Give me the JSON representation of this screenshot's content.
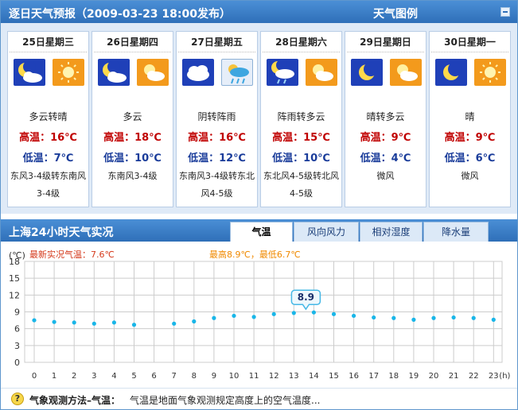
{
  "header": {
    "title": "逐日天气预报（2009-03-23 18:00发布）",
    "right_label": "天气图例"
  },
  "forecast": [
    {
      "date": "25日星期三",
      "desc": "多云转晴",
      "high": "高温：16℃",
      "low": "低温：7℃",
      "wind": "东风3-4级转东南风3-4级",
      "icon_night": "cloudy-moon-icon",
      "icon_day": "sun-icon"
    },
    {
      "date": "26日星期四",
      "desc": "多云",
      "high": "高温：18℃",
      "low": "低温：10℃",
      "wind": "东南风3-4级",
      "icon_night": "cloudy-moon-icon",
      "icon_day": "partly-cloudy-sun-icon"
    },
    {
      "date": "27日星期五",
      "desc": "阴转阵雨",
      "high": "高温：16℃",
      "low": "低温：12℃",
      "wind": "东南风3-4级转东北风4-5级",
      "icon_night": "overcast-icon",
      "icon_day": "shower-icon"
    },
    {
      "date": "28日星期六",
      "desc": "阵雨转多云",
      "high": "高温：15℃",
      "low": "低温：10℃",
      "wind": "东北风4-5级转北风4-5级",
      "icon_night": "rain-moon-icon",
      "icon_day": "partly-cloudy-sun-icon"
    },
    {
      "date": "29日星期日",
      "desc": "晴转多云",
      "high": "高温：9℃",
      "low": "低温：4℃",
      "wind": "微风",
      "icon_night": "moon-icon",
      "icon_day": "partly-cloudy-sun-icon"
    },
    {
      "date": "30日星期一",
      "desc": "晴",
      "high": "高温：9℃",
      "low": "低温：6℃",
      "wind": "微风",
      "icon_night": "moon-icon",
      "icon_day": "sun-icon"
    }
  ],
  "observation": {
    "title": "上海24小时天气实况",
    "tabs": [
      "气温",
      "风向风力",
      "相对湿度",
      "降水量"
    ],
    "active_tab": "气温",
    "latest": "最新实况气温：7.6℃",
    "hilo": "最高8.9℃，最低6.7℃",
    "unit": "(℃)",
    "x_unit": "(h)",
    "highlight_label": "8.9"
  },
  "chart_data": {
    "type": "scatter",
    "title": "",
    "xlabel": "(h)",
    "ylabel": "(℃)",
    "ylim": [
      0,
      18
    ],
    "yticks": [
      0,
      3,
      6,
      9,
      12,
      15,
      18
    ],
    "xticks": [
      0,
      1,
      2,
      3,
      4,
      5,
      6,
      7,
      8,
      9,
      10,
      11,
      12,
      13,
      14,
      15,
      16,
      17,
      18,
      19,
      20,
      21,
      22,
      23
    ],
    "grid": true,
    "series": [
      {
        "points": [
          [
            0,
            7.5
          ],
          [
            1,
            7.2
          ],
          [
            2,
            7.1
          ],
          [
            3,
            6.9
          ],
          [
            4,
            7.1
          ],
          [
            5,
            6.7
          ],
          [
            7,
            6.9
          ],
          [
            8,
            7.3
          ],
          [
            9,
            7.9
          ],
          [
            10,
            8.3
          ],
          [
            11,
            8.1
          ],
          [
            12,
            8.6
          ],
          [
            13,
            8.8
          ],
          [
            14,
            8.9
          ],
          [
            15,
            8.6
          ],
          [
            16,
            8.3
          ],
          [
            17,
            8.0
          ],
          [
            18,
            7.9
          ],
          [
            19,
            7.6
          ],
          [
            20,
            7.9
          ],
          [
            21,
            8.0
          ],
          [
            22,
            7.9
          ],
          [
            23,
            7.6
          ]
        ]
      }
    ],
    "highlight": {
      "x": 14,
      "y": 8.9
    }
  },
  "footer": {
    "bold": "气象观测方法–气温：",
    "text": "气温是地面气象观测规定高度上的空气温度..."
  },
  "colors": {
    "header_blue": "#2f6fb8",
    "point_cyan": "#19b6e8",
    "grid": "#cccccc",
    "high_red": "#c00000",
    "low_blue": "#1a3c9a"
  }
}
